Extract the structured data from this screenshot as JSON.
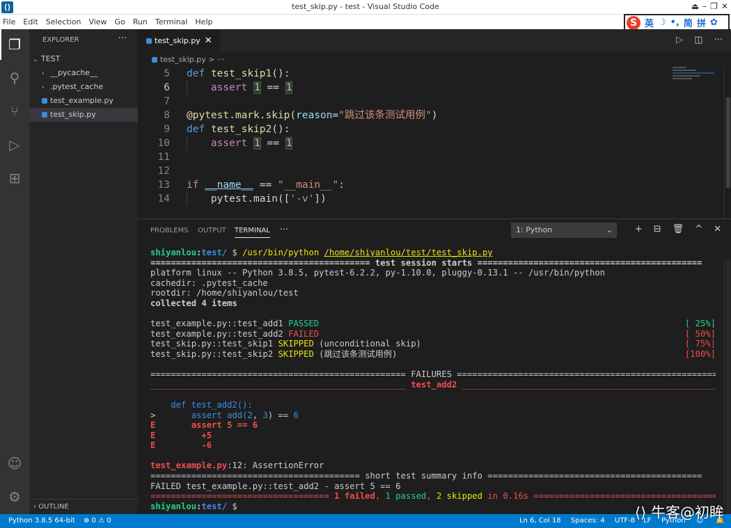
{
  "window": {
    "title": "test_skip.py - test - Visual Studio Code",
    "logo": "vscode-logo"
  },
  "menu": [
    "File",
    "Edit",
    "Selection",
    "View",
    "Go",
    "Run",
    "Terminal",
    "Help"
  ],
  "ime": {
    "brand": "S",
    "items": [
      "英",
      "☽",
      "•,",
      "简",
      "拼",
      "✿"
    ]
  },
  "explorer": {
    "header": "EXPLORER",
    "more": "···",
    "root": "TEST",
    "items": [
      {
        "label": "__pycache__",
        "type": "folder"
      },
      {
        "label": ".pytest_cache",
        "type": "folder"
      },
      {
        "label": "test_example.py",
        "type": "file"
      },
      {
        "label": "test_skip.py",
        "type": "file",
        "selected": true
      }
    ],
    "outline": "OUTLINE"
  },
  "editor": {
    "tab": "test_skip.py",
    "breadcrumb": "test_skip.py > ···",
    "lines": [
      {
        "n": "5"
      },
      {
        "n": "6"
      },
      {
        "n": "7"
      },
      {
        "n": "8"
      },
      {
        "n": "9"
      },
      {
        "n": "10"
      },
      {
        "n": "11"
      },
      {
        "n": "12"
      },
      {
        "n": "13"
      },
      {
        "n": "14"
      }
    ],
    "code": {
      "l5_def": "def",
      "l5_fn": "test_skip1",
      "l5_rest": "():",
      "l6_kw": "assert",
      "l6_a": "1",
      "l6_op": " == ",
      "l6_b": "1",
      "l8_dec": "@pytest.mark.skip",
      "l8_p": "(",
      "l8_prm": "reason",
      "l8_eq": "=",
      "l8_str": "\"跳过该条测试用例\"",
      "l8_end": ")",
      "l9_def": "def",
      "l9_fn": "test_skip2",
      "l9_rest": "():",
      "l10_kw": "assert",
      "l10_a": "1",
      "l10_op": " == ",
      "l10_b": "1",
      "l13_if": "if",
      "l13_name": "__name__",
      "l13_op": " == ",
      "l13_str": "\"__main__\"",
      "l13_col": ":",
      "l14_code": "pytest.main([",
      "l14_str": "'-v'",
      "l14_end": "])"
    }
  },
  "panel": {
    "tabs": [
      "PROBLEMS",
      "OUTPUT",
      "TERMINAL"
    ],
    "active_tab": "TERMINAL",
    "more": "···",
    "terminal_select": "1: Python",
    "actions": [
      "+",
      "⊟",
      "🗑",
      "^",
      "✕"
    ]
  },
  "terminal": {
    "prompt_user": "shiyanlou",
    "prompt_dir": "test/",
    "prompt_sym": " $ ",
    "cmd_py": "/usr/bin/python",
    "cmd_file": "/home/shiyanlou/test/test_skip.py",
    "session_left": "=========================================== ",
    "session_title": "test session starts",
    "session_right": " ============================================",
    "platform": "platform linux -- Python 3.8.5, pytest-6.2.2, py-1.10.0, pluggy-0.13.1 -- /usr/bin/python",
    "cachedir": "cachedir: .pytest_cache",
    "rootdir": "rootdir: /home/shiyanlou/test",
    "collected": "collected 4 items",
    "results": [
      {
        "name": "test_example.py::test_add1 ",
        "status": "PASSED",
        "extra": "",
        "pct": "[ 25%]",
        "color": "g"
      },
      {
        "name": "test_example.py::test_add2 ",
        "status": "FAILED",
        "extra": "",
        "pct": "[ 50%]",
        "color": "rd"
      },
      {
        "name": "test_skip.py::test_skip1 ",
        "status": "SKIPPED",
        "extra": " (unconditional skip)",
        "pct": "[ 75%]",
        "color": "y"
      },
      {
        "name": "test_skip.py::test_skip2 ",
        "status": "SKIPPED",
        "extra": " (跳过该条测试用例)",
        "pct": "[100%]",
        "color": "y"
      }
    ],
    "failures_left": "================================================== ",
    "failures_title": "FAILURES",
    "failures_right": " ===================================================",
    "fail_sub_left": "__________________________________________________ ",
    "fail_sub_title": "test_add2",
    "fail_sub_right": " _____________________________________________________",
    "tb_def": "    def test_add2():",
    "tb_gt": ">",
    "tb_assert": "       assert add(",
    "tb_a2": "2",
    "tb_comma": ", ",
    "tb_a3": "3",
    "tb_eq": ") == ",
    "tb_6": "6",
    "e1_e": "E",
    "e1": "       assert 5 == 6",
    "e2_e": "E",
    "e2": "         +5",
    "e3_e": "E",
    "e3": "         -6",
    "loc_file": "test_example.py",
    "loc_rest": ":12: AssertionError",
    "short_left": "========================================= ",
    "short_title": "short test summary info",
    "short_right": " ==========================================",
    "failed_line": "FAILED test_example.py::test_add2 - assert 5 == 6",
    "sum_left": "=================================== ",
    "sum_failed": "1 failed",
    "sum_c1": ", ",
    "sum_passed": "1 passed",
    "sum_c2": ", ",
    "sum_skipped": "2 skipped",
    "sum_in": " in 0.16s",
    "sum_right": " ===================================="
  },
  "status": {
    "python": "Python 3.8.5 64-bit",
    "problems": "⊗ 0 ⚠ 0",
    "position": "Ln 6, Col 18",
    "spaces": "Spaces: 4",
    "encoding": "UTF-8",
    "eol": "LF",
    "lang": "Python"
  },
  "watermark": "牛客@初眸"
}
